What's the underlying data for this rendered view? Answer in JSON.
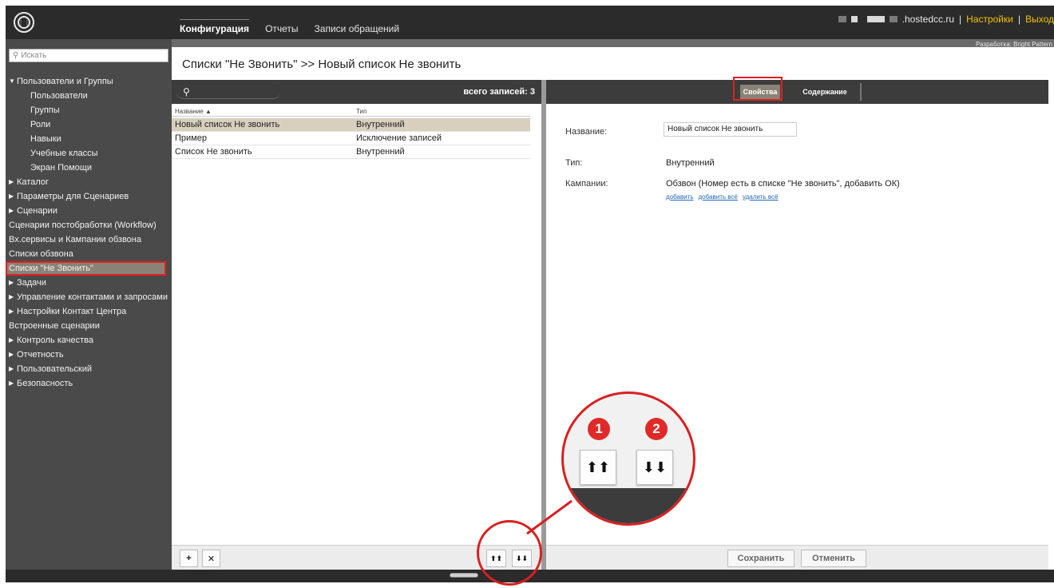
{
  "topbar": {
    "tabs": [
      {
        "label": "Конфигурация",
        "active": true
      },
      {
        "label": "Отчеты",
        "active": false
      },
      {
        "label": "Записи обращений",
        "active": false
      }
    ],
    "domain": ".hostedcc.ru",
    "separator": "|",
    "settings_label": "Настройки",
    "logout_label": "Выход",
    "developer_note": "Разработка: Bright Pattern",
    "accent_color": "#f2c200"
  },
  "sidebar": {
    "search_placeholder": "Искать",
    "items": [
      {
        "label": "Пользователи и Группы",
        "expanded": true
      },
      {
        "label": "Пользователи"
      },
      {
        "label": "Группы"
      },
      {
        "label": "Роли"
      },
      {
        "label": "Навыки"
      },
      {
        "label": "Учебные классы"
      },
      {
        "label": "Экран Помощи"
      },
      {
        "label": "Каталог"
      },
      {
        "label": "Параметры для Сценариев"
      },
      {
        "label": "Сценарии"
      },
      {
        "label": "Сценарии постобработки (Workflow)"
      },
      {
        "label": "Вх.сервисы и Кампании обзвона"
      },
      {
        "label": "Списки обзвона"
      },
      {
        "label": "Списки \"Не Звонить\"",
        "selected": true
      },
      {
        "label": "Задачи"
      },
      {
        "label": "Управление контактами и запросами"
      },
      {
        "label": "Настройки Контакт Центра"
      },
      {
        "label": "Встроенные сценарии"
      },
      {
        "label": "Контроль качества"
      },
      {
        "label": "Отчетность"
      },
      {
        "label": "Пользовательский"
      },
      {
        "label": "Безопасность"
      }
    ]
  },
  "page": {
    "title": "Списки \"Не Звонить\" >> Новый список Не звонить"
  },
  "list": {
    "total_label": "всего записей: 3",
    "columns": [
      "Название ▲",
      "Тип"
    ],
    "rows": [
      {
        "name": "Новый список Не звонить",
        "type": "Внутренний",
        "selected": true
      },
      {
        "name": "Пример",
        "type": "Исключение записей"
      },
      {
        "name": "Список Не звонить",
        "type": "Внутренний"
      }
    ],
    "add_label": "+",
    "delete_label": "✕",
    "import_label": "⬆⬆",
    "export_label": "⬇⬇"
  },
  "details": {
    "tabs": [
      {
        "label": "Свойства",
        "active": true
      },
      {
        "label": "Содержание",
        "active": false
      }
    ],
    "name_label": "Название:",
    "name_value": "Новый список Не звонить",
    "type_label": "Тип:",
    "type_value": "Внутренний",
    "campaigns_label": "Кампании:",
    "campaigns_value": "Обзвон (Номер есть в списке \"Не звонить\", добавить ОК)",
    "links": [
      "добавить",
      "добавить всё",
      "удалить всё"
    ],
    "save_label": "Сохранить",
    "cancel_label": "Отменить"
  },
  "callout": {
    "badge_1": "1",
    "badge_2": "2",
    "button_1": "⬆⬆",
    "button_2": "⬇⬇",
    "highlight_color": "#d82020"
  }
}
